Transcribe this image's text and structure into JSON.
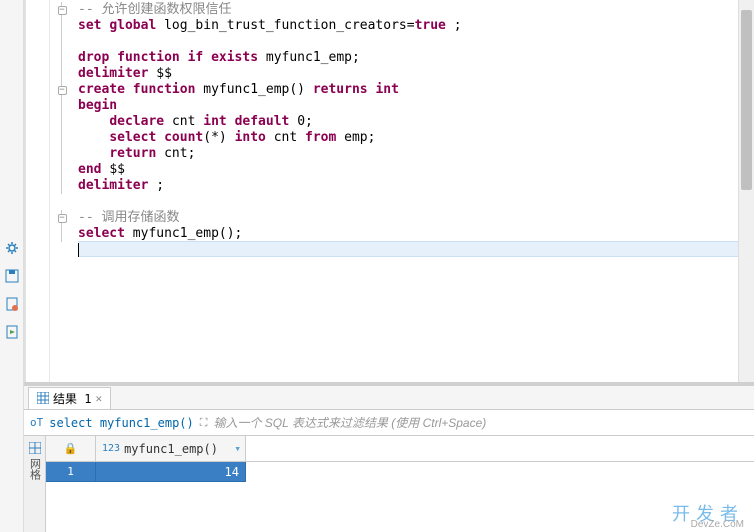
{
  "editor": {
    "lines": [
      {
        "type": "comment",
        "dash": "-- ",
        "text": "允许创建函数权限信任"
      },
      {
        "type": "code",
        "tokens": [
          [
            "kw",
            "set"
          ],
          [
            "sp",
            " "
          ],
          [
            "kw",
            "global"
          ],
          [
            "sp",
            " "
          ],
          [
            "id",
            "log_bin_trust_function_creators"
          ],
          [
            "op",
            "="
          ],
          [
            "bool",
            "true"
          ],
          [
            "sp",
            " "
          ],
          [
            "op",
            ";"
          ]
        ]
      },
      {
        "type": "blank"
      },
      {
        "type": "code",
        "tokens": [
          [
            "kw",
            "drop"
          ],
          [
            "sp",
            " "
          ],
          [
            "kw",
            "function"
          ],
          [
            "sp",
            " "
          ],
          [
            "kw",
            "if"
          ],
          [
            "sp",
            " "
          ],
          [
            "kw",
            "exists"
          ],
          [
            "sp",
            " "
          ],
          [
            "id",
            "myfunc1_emp"
          ],
          [
            "op",
            ";"
          ]
        ]
      },
      {
        "type": "code",
        "tokens": [
          [
            "kw",
            "delimiter"
          ],
          [
            "sp",
            " "
          ],
          [
            "id",
            "$$"
          ]
        ]
      },
      {
        "type": "code",
        "tokens": [
          [
            "kw",
            "create"
          ],
          [
            "sp",
            " "
          ],
          [
            "kw",
            "function"
          ],
          [
            "sp",
            " "
          ],
          [
            "id",
            "myfunc1_emp"
          ],
          [
            "op",
            "()"
          ],
          [
            "sp",
            " "
          ],
          [
            "kw",
            "returns"
          ],
          [
            "sp",
            " "
          ],
          [
            "kw",
            "int"
          ]
        ]
      },
      {
        "type": "code",
        "tokens": [
          [
            "kw",
            "begin"
          ]
        ]
      },
      {
        "type": "code",
        "indent": "    ",
        "tokens": [
          [
            "kw",
            "declare"
          ],
          [
            "sp",
            " "
          ],
          [
            "id",
            "cnt"
          ],
          [
            "sp",
            " "
          ],
          [
            "kw",
            "int"
          ],
          [
            "sp",
            " "
          ],
          [
            "kw",
            "default"
          ],
          [
            "sp",
            " "
          ],
          [
            "num",
            "0"
          ],
          [
            "op",
            ";"
          ]
        ]
      },
      {
        "type": "code",
        "indent": "    ",
        "tokens": [
          [
            "kw",
            "select"
          ],
          [
            "sp",
            " "
          ],
          [
            "kw",
            "count"
          ],
          [
            "op",
            "(*)"
          ],
          [
            "sp",
            " "
          ],
          [
            "kw",
            "into"
          ],
          [
            "sp",
            " "
          ],
          [
            "id",
            "cnt"
          ],
          [
            "sp",
            " "
          ],
          [
            "kw",
            "from"
          ],
          [
            "sp",
            " "
          ],
          [
            "id",
            "emp"
          ],
          [
            "op",
            ";"
          ]
        ]
      },
      {
        "type": "code",
        "indent": "    ",
        "tokens": [
          [
            "kw",
            "return"
          ],
          [
            "sp",
            " "
          ],
          [
            "id",
            "cnt"
          ],
          [
            "op",
            ";"
          ]
        ]
      },
      {
        "type": "code",
        "tokens": [
          [
            "kw",
            "end"
          ],
          [
            "sp",
            " "
          ],
          [
            "id",
            "$$"
          ]
        ]
      },
      {
        "type": "code",
        "tokens": [
          [
            "kw",
            "delimiter"
          ],
          [
            "sp",
            " "
          ],
          [
            "op",
            ";"
          ]
        ]
      },
      {
        "type": "blank"
      },
      {
        "type": "comment",
        "dash": "-- ",
        "text": "调用存储函数"
      },
      {
        "type": "code",
        "tokens": [
          [
            "kw",
            "select"
          ],
          [
            "sp",
            " "
          ],
          [
            "id",
            "myfunc1_emp"
          ],
          [
            "op",
            "();"
          ]
        ]
      },
      {
        "type": "current"
      }
    ],
    "fold_marks": {
      "0": "⊖",
      "5": "⊖",
      "13": "⊖"
    }
  },
  "results": {
    "tab_label": "结果 1",
    "sql_text": "select myfunc1_emp()",
    "filter_hint": "输入一个 SQL 表达式来过滤结果 (使用 Ctrl+Space)",
    "vtab_label": "网格",
    "column": {
      "type_badge": "123",
      "name": "myfunc1_emp()"
    },
    "rows": [
      {
        "num": "1",
        "val": "14"
      }
    ]
  },
  "watermark": {
    "main": "开发者",
    "sub": "DevZe.CoM"
  }
}
